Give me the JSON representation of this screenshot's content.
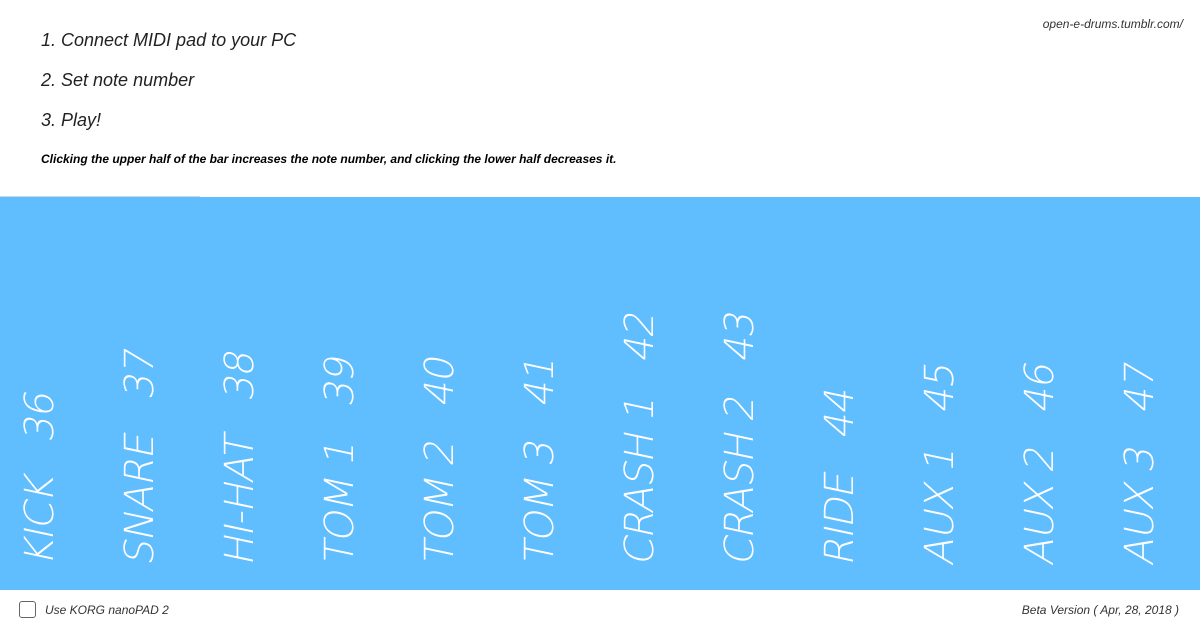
{
  "header": {
    "url": "open-e-drums.tumblr.com/",
    "steps": [
      "1. Connect MIDI pad to your PC",
      "2. Set note number",
      "3. Play!"
    ],
    "hint": "Clicking the upper half of the bar increases the note number, and clicking the lower half decreases it."
  },
  "pads": [
    {
      "label": "KICK   36",
      "note": 36
    },
    {
      "label": "SNARE   37",
      "note": 37
    },
    {
      "label": "HI-HAT   38",
      "note": 38
    },
    {
      "label": "TOM 1   39",
      "note": 39
    },
    {
      "label": "TOM 2   40",
      "note": 40
    },
    {
      "label": "TOM 3   41",
      "note": 41
    },
    {
      "label": "CRASH 1   42",
      "note": 42
    },
    {
      "label": "CRASH 2   43",
      "note": 43
    },
    {
      "label": "RIDE   44",
      "note": 44
    },
    {
      "label": "AUX 1   45",
      "note": 45
    },
    {
      "label": "AUX 2   46",
      "note": 46
    },
    {
      "label": "AUX 3   47",
      "note": 47
    }
  ],
  "footer": {
    "checkbox_label": "Use KORG nanoPAD 2",
    "checkbox_checked": false,
    "version": "Beta Version ( Apr, 28, 2018 )"
  },
  "colors": {
    "pad_background": "#60bdfe",
    "pad_text": "#ffffff"
  }
}
